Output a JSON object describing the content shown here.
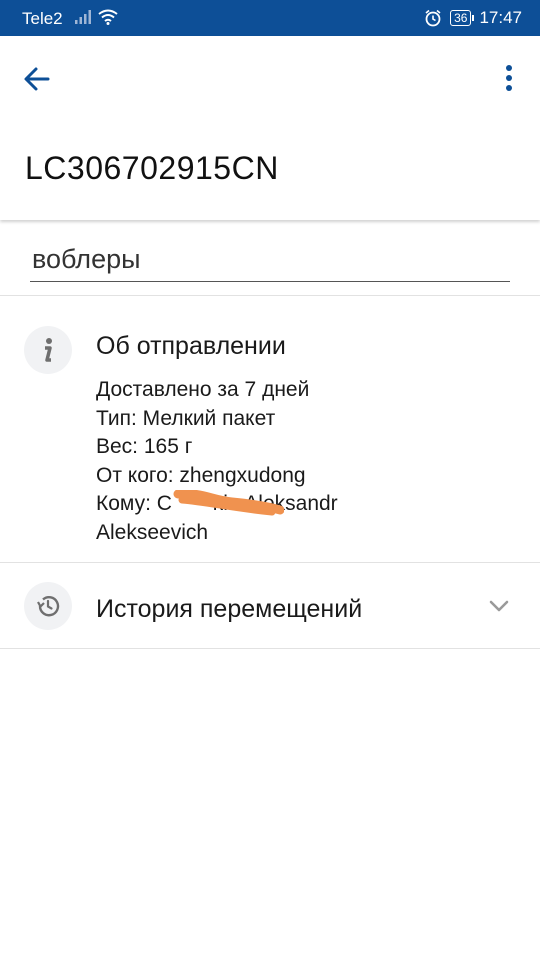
{
  "status_bar": {
    "carrier": "Tele2",
    "battery": "36",
    "time": "17:47"
  },
  "header": {
    "title": "LC306702915CN"
  },
  "name_field": {
    "value": "воблеры"
  },
  "shipment_info": {
    "title": "Об отправлении",
    "delivered": "Доставлено за 7 дней",
    "type": "Тип: Мелкий пакет",
    "weight": "Вес: 165 г",
    "from": "От кого: zhengxudong",
    "to": "Кому: C       kin Aleksandr",
    "to_cont": "Alekseevich"
  },
  "history": {
    "title": "История перемещений"
  },
  "colors": {
    "status_bar": "#0d4f97",
    "accent": "#0d4f97",
    "redaction": "#f0924f"
  }
}
